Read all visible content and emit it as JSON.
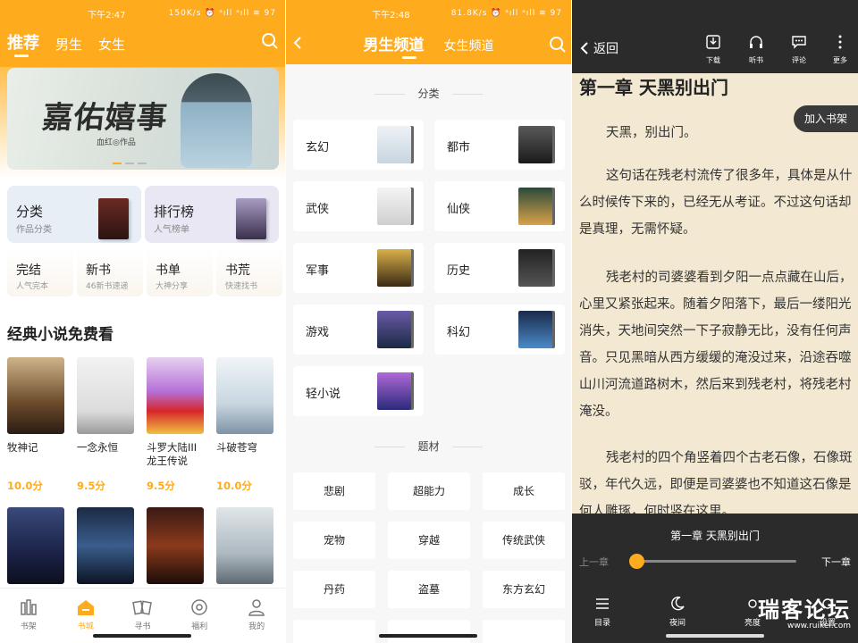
{
  "panel1": {
    "status": {
      "time": "下午2:47",
      "info": "150K/s ⏰ ᵃıll ᵃıll ≋ 97"
    },
    "tabs": [
      "推荐",
      "男生",
      "女生"
    ],
    "banner": {
      "title": "嘉佑嬉事",
      "author": "血红◎作品"
    },
    "cards_big": [
      {
        "title": "分类",
        "sub": "作品分类"
      },
      {
        "title": "排行榜",
        "sub": "人气榜单"
      }
    ],
    "cards_small": [
      {
        "title": "完结",
        "sub": "人气完本"
      },
      {
        "title": "新书",
        "sub": "46新书速递"
      },
      {
        "title": "书单",
        "sub": "大神分享"
      },
      {
        "title": "书荒",
        "sub": "快速找书"
      }
    ],
    "section_title": "经典小说免费看",
    "books_row1": [
      {
        "name": "牧神记",
        "score": "10.0分",
        "cover": "牧神记"
      },
      {
        "name": "一念永恒",
        "score": "9.5分",
        "cover": "一念永恒"
      },
      {
        "name": "斗罗大陆III龙王传说",
        "score": "9.5分",
        "cover": "斗罗大陆 龙王传说"
      },
      {
        "name": "斗破苍穹",
        "score": "10.0分",
        "cover": "斗破苍穹"
      }
    ],
    "books_row2": [
      {
        "cover": "打眼"
      },
      {
        "cover": "全球高武"
      },
      {
        "cover": "诡秘之主"
      },
      {
        "cover": "圣墟"
      }
    ],
    "nav": [
      {
        "label": "书架",
        "icon": "bookshelf-icon"
      },
      {
        "label": "书城",
        "icon": "home-icon"
      },
      {
        "label": "寻书",
        "icon": "find-book-icon"
      },
      {
        "label": "福利",
        "icon": "benefit-icon"
      },
      {
        "label": "我的",
        "icon": "profile-icon"
      }
    ]
  },
  "panel2": {
    "status": {
      "time": "下午2:48",
      "info": "81.8K/s ⏰ ᵃıll ᵃıll ≋ 97"
    },
    "tabs": [
      "男生频道",
      "女生频道"
    ],
    "section1": "分类",
    "categories": [
      "玄幻",
      "都市",
      "武侠",
      "仙侠",
      "军事",
      "历史",
      "游戏",
      "科幻",
      "轻小说"
    ],
    "section2": "题材",
    "themes": [
      "悲剧",
      "超能力",
      "成长",
      "宠物",
      "穿越",
      "传统武侠",
      "丹药",
      "盗墓",
      "东方玄幻"
    ]
  },
  "panel3": {
    "back": "返回",
    "tools": [
      "下载",
      "听书",
      "评论",
      "更多"
    ],
    "chapter_title": "第一章 天黑别出门",
    "add_shelf": "加入书架",
    "paragraphs": [
      "天黑，别出门。",
      "这句话在残老村流传了很多年，具体是从什么时候传下来的，已经无从考证。不过这句话却是真理，无需怀疑。",
      "残老村的司婆婆看到夕阳一点点藏在山后，心里又紧张起来。随着夕阳落下，最后一缕阳光消失，天地间突然一下子寂静无比，没有任何声音。只见黑暗从西方缓缓的淹没过来，沿途吞噬山川河流道路树木，然后来到残老村，将残老村淹没。",
      "残老村的四个角竖着四个古老石像，石像斑驳，年代久远，即便是司婆婆也不知道这石像是何人雕琢，何时竖在这里。"
    ],
    "bottom": {
      "chapter": "第一章 天黑别出门",
      "prev": "上一章",
      "next": "下一章",
      "progress": 0.0,
      "items": [
        "目录",
        "夜间",
        "亮度",
        "设置"
      ]
    },
    "watermark": {
      "name": "瑞客论坛",
      "url": "www.ruikei.com"
    }
  },
  "colors": {
    "accent": "#ffab1e",
    "dark": "#2b2b2b",
    "paper": "#f3e9d3"
  }
}
